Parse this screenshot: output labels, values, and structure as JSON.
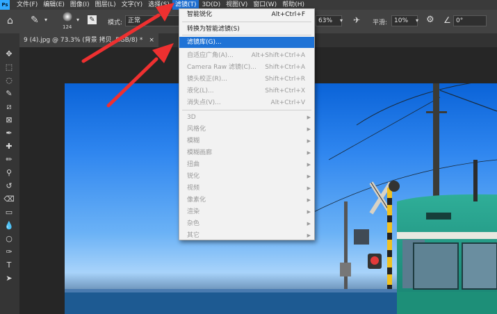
{
  "app": {
    "logo": "Ps"
  },
  "menubar": {
    "items": [
      "文件(F)",
      "编辑(E)",
      "图像(I)",
      "图层(L)",
      "文字(Y)",
      "选择(S)",
      "滤镜(T)",
      "3D(D)",
      "视图(V)",
      "窗口(W)",
      "帮助(H)"
    ],
    "active_index": 6
  },
  "options_bar": {
    "brush_size": "124",
    "mode_label": "模式:",
    "mode_value": "正常",
    "flow_value": "63%",
    "smoothing_label": "平滑:",
    "smoothing_value": "10%",
    "angle_value": "0°"
  },
  "document_tab": {
    "title": "9 (4).jpg @ 73.3% (背景 拷贝, RGB/8) *",
    "close": "×"
  },
  "filter_menu": {
    "items": [
      {
        "label": "智能锐化",
        "shortcut": "Alt+Ctrl+F",
        "state": "normal"
      },
      {
        "label": "转换为智能滤镜(S)",
        "shortcut": "",
        "state": "normal"
      },
      {
        "label": "滤镜库(G)...",
        "shortcut": "",
        "state": "highlighted"
      },
      {
        "label": "自适应广角(A)...",
        "shortcut": "Alt+Shift+Ctrl+A",
        "state": "disabled"
      },
      {
        "label": "Camera Raw 滤镜(C)...",
        "shortcut": "Shift+Ctrl+A",
        "state": "disabled"
      },
      {
        "label": "镜头校正(R)...",
        "shortcut": "Shift+Ctrl+R",
        "state": "disabled"
      },
      {
        "label": "液化(L)...",
        "shortcut": "Shift+Ctrl+X",
        "state": "disabled"
      },
      {
        "label": "消失点(V)...",
        "shortcut": "Alt+Ctrl+V",
        "state": "disabled"
      },
      {
        "label": "3D",
        "submenu": true,
        "state": "disabled"
      },
      {
        "label": "风格化",
        "submenu": true,
        "state": "disabled"
      },
      {
        "label": "模糊",
        "submenu": true,
        "state": "disabled"
      },
      {
        "label": "模糊画廊",
        "submenu": true,
        "state": "disabled"
      },
      {
        "label": "扭曲",
        "submenu": true,
        "state": "disabled"
      },
      {
        "label": "锐化",
        "submenu": true,
        "state": "disabled"
      },
      {
        "label": "视频",
        "submenu": true,
        "state": "disabled"
      },
      {
        "label": "像素化",
        "submenu": true,
        "state": "disabled"
      },
      {
        "label": "渲染",
        "submenu": true,
        "state": "disabled"
      },
      {
        "label": "杂色",
        "submenu": true,
        "state": "disabled"
      },
      {
        "label": "其它",
        "submenu": true,
        "state": "disabled"
      }
    ],
    "submenu_arrow": "▶"
  },
  "colors": {
    "menu_highlight": "#1f73d6",
    "annotation_arrow": "#ee3030"
  },
  "tools": [
    "move-tool",
    "marquee-tool",
    "lasso-tool",
    "quick-select-tool",
    "crop-tool",
    "frame-tool",
    "eyedropper-tool",
    "healing-brush-tool",
    "brush-tool",
    "clone-stamp-tool",
    "history-brush-tool",
    "eraser-tool",
    "gradient-tool",
    "blur-tool",
    "dodge-tool",
    "pen-tool",
    "type-tool",
    "path-select-tool"
  ]
}
